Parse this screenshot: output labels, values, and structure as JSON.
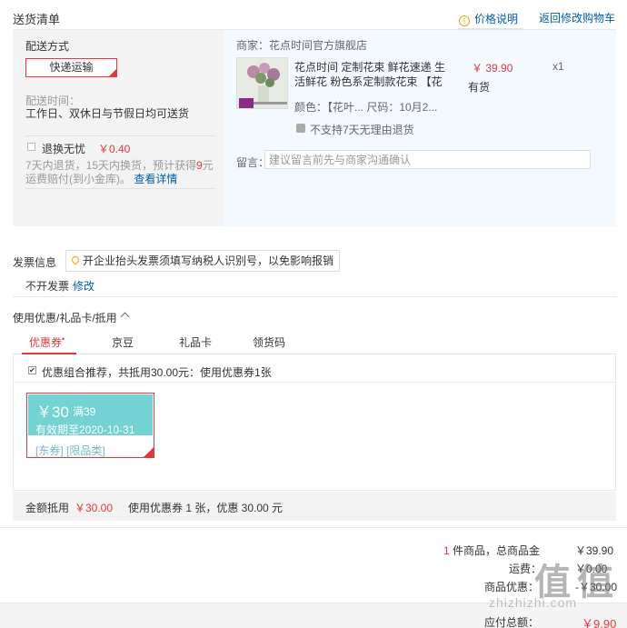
{
  "header": {
    "title": "送货清单",
    "price_info": "价格说明",
    "back_cart": "返回修改购物车"
  },
  "delivery": {
    "method_label": "配送方式",
    "method_value": "快递运输",
    "time_label": "配送时间：",
    "time_value": "工作日、双休日与节假日均可送货",
    "exchange_label": "退换无忧",
    "exchange_price": "￥0.40",
    "exchange_desc_a": "7天内退货，15天内换货，预计获得",
    "exchange_desc_num": "9",
    "exchange_desc_b": "元运费赔付(到小金库)。",
    "exchange_link": "查看详情"
  },
  "order": {
    "shop": "商家：花点时间官方旗舰店",
    "product_title": "花点时间 定制花束 鲜花速递 生活鲜花 粉色系定制款花束 【花",
    "price": "￥ 39.90",
    "qty": "x1",
    "stock": "有货",
    "attr": "颜色：【花叶... 尺码：10月2...",
    "no_return": "不支持7天无理由退货",
    "message_label": "留言：",
    "message_placeholder": "建议留言前先与商家沟通确认"
  },
  "invoice": {
    "label": "发票信息",
    "tip": "开企业抬头发票须填写纳税人识别号，以免影响报销",
    "value": "不开发票",
    "edit": "修改"
  },
  "coupons": {
    "title": "使用优惠/礼品卡/抵用",
    "tabs": [
      "优惠券",
      "京豆",
      "礼品卡",
      "领货码"
    ],
    "tab_mark": "•",
    "combo_text": "优惠组合推荐，共抵用30.00元：使用优惠券1张",
    "card": {
      "amount": "￥30",
      "condition": "满39",
      "valid": "有效期至2020-10-31",
      "tags": "[东券]  [限品类]"
    },
    "summary_label": "金额抵用",
    "summary_amount": "￥30.00",
    "summary_use": "使用优惠券 1 张，优惠 30.00 元"
  },
  "totals": {
    "count": "1",
    "items_label": " 件商品，总商品金",
    "items_value": "￥39.90",
    "row2_label": "运费：",
    "row2_value": "￥0.00",
    "row3_label": "商品优惠：",
    "row3_value": "-￥30.00",
    "pay_label": "应付总额：",
    "pay_value": "￥9.90"
  },
  "watermark": {
    "text": "值 值",
    "url": "zhizhizhi.com"
  },
  "colors": {
    "accent": "#e4393c",
    "link": "#005ea7",
    "coupon": "#74d2d4"
  }
}
